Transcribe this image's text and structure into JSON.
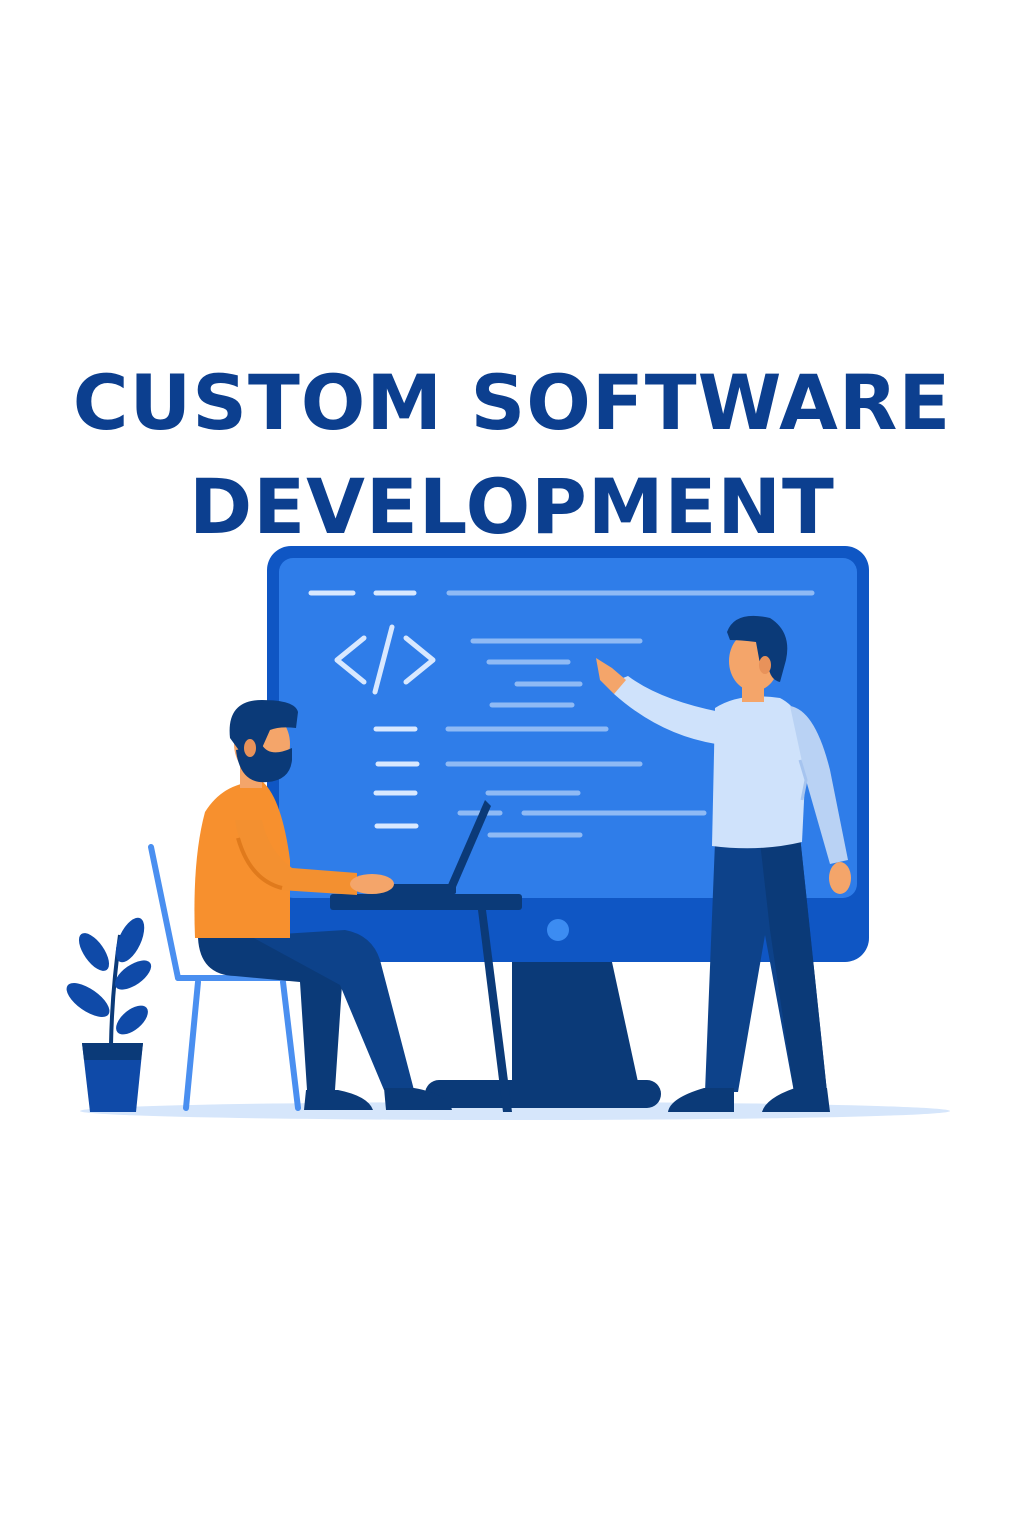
{
  "title": {
    "line1": "CUSTOM SOFTWARE",
    "line2": "DEVELOPMENT"
  },
  "illustration": {
    "code_symbol": "</>",
    "colors": {
      "title": "#0c3f8f",
      "screen": "#2f7de9",
      "monitor_frame": "#0f56c4",
      "dark_navy": "#0b3a78",
      "orange_shirt": "#f7902e",
      "light_shirt": "#cfe2fb",
      "skin": "#f4a56a",
      "chair": "#4a8ff0",
      "floor": "#d6e6fb"
    }
  }
}
